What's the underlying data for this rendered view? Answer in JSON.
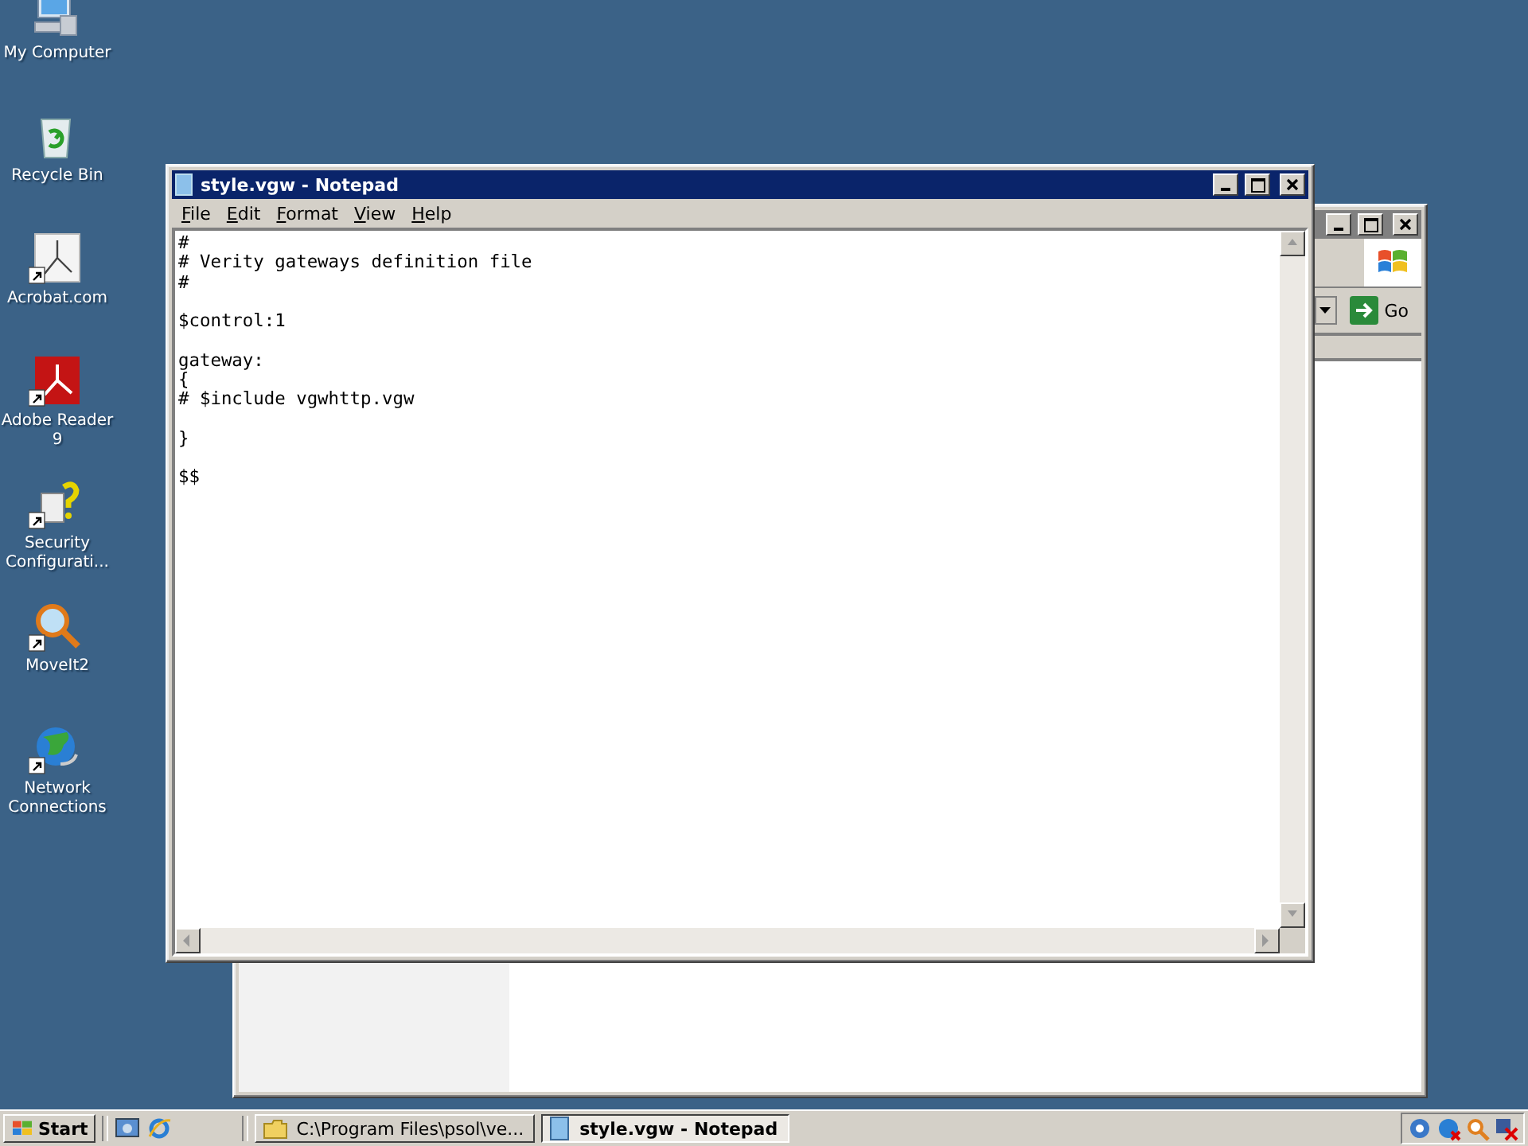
{
  "desktop_icons": [
    {
      "kind": "computer",
      "label": "My Computer",
      "shortcut": false
    },
    {
      "kind": "recycle",
      "label": "Recycle Bin",
      "shortcut": false
    },
    {
      "kind": "acrobat",
      "label": "Acrobat.com",
      "shortcut": true
    },
    {
      "kind": "reader",
      "label": "Adobe Reader 9",
      "shortcut": true
    },
    {
      "kind": "security",
      "label": "Security Configurati...",
      "shortcut": true
    },
    {
      "kind": "magnifier",
      "label": "MoveIt2",
      "shortcut": true
    },
    {
      "kind": "globe",
      "label": "Network Connections",
      "shortcut": true
    }
  ],
  "background_window": {
    "address_button": "Go"
  },
  "notepad": {
    "title": "style.vgw - Notepad",
    "active": true,
    "menu": [
      "File",
      "Edit",
      "Format",
      "View",
      "Help"
    ],
    "text": "#\n# Verity gateways definition file\n#\n\n$control:1\n\ngateway:\n{\n# $include vgwhttp.vgw\n\n}\n\n$$"
  },
  "taskbar": {
    "start": "Start",
    "tasks": [
      {
        "kind": "folder",
        "label": "C:\\Program Files\\psol\\ve...",
        "selected": false
      },
      {
        "kind": "notepad",
        "label": "style.vgw - Notepad",
        "selected": true
      }
    ]
  }
}
